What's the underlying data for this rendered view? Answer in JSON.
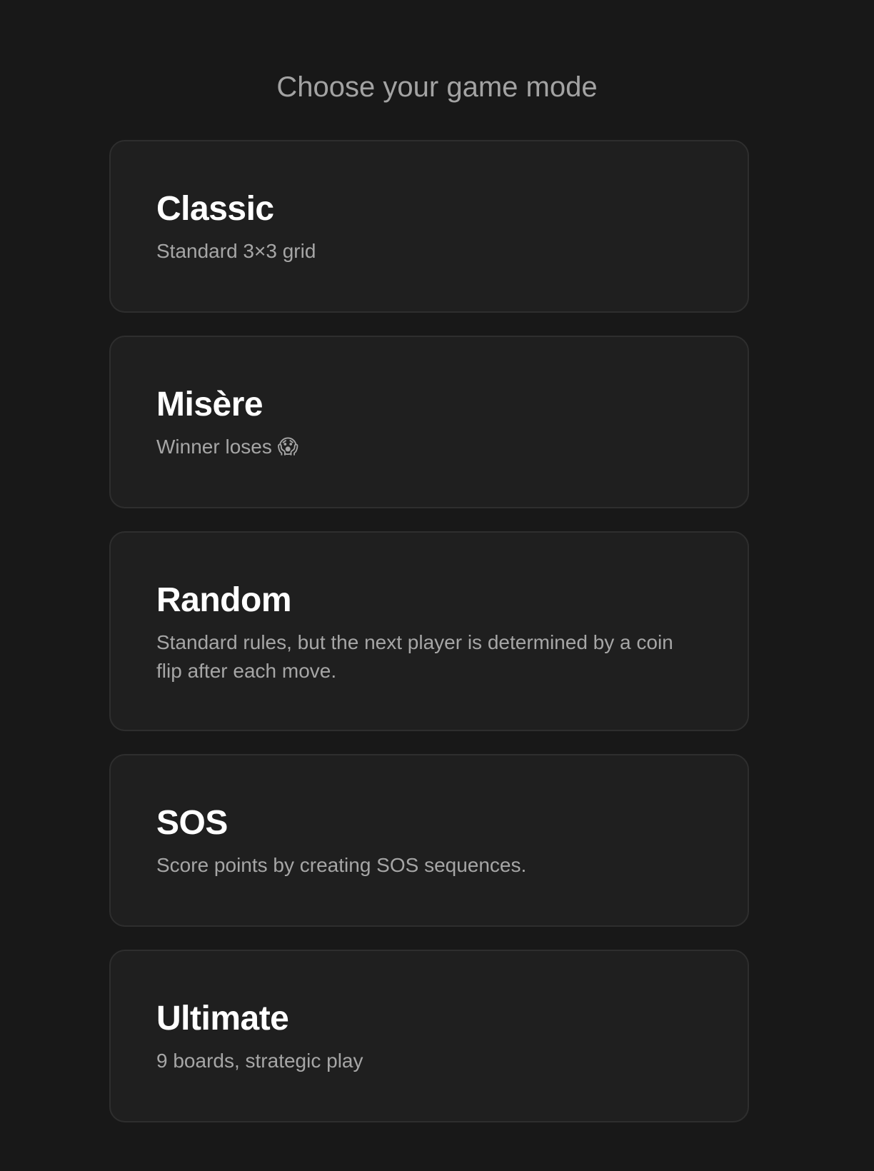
{
  "header": {
    "title": "Choose your game mode"
  },
  "modes": [
    {
      "name": "Classic",
      "description": "Standard 3×3 grid"
    },
    {
      "name": "Misère",
      "description": "Winner loses 😱"
    },
    {
      "name": "Random",
      "description": "Standard rules, but the next player is determined by a coin flip after each move."
    },
    {
      "name": "SOS",
      "description": "Score points by creating SOS sequences."
    },
    {
      "name": "Ultimate",
      "description": "9 boards, strategic play"
    }
  ],
  "colors": {
    "background": "#181818",
    "card": "#1f1f1f",
    "card_border": "#2e2e2e",
    "title_text": "#a3a3a3",
    "description_text": "#a6a6a6",
    "name_text": "#ffffff"
  }
}
